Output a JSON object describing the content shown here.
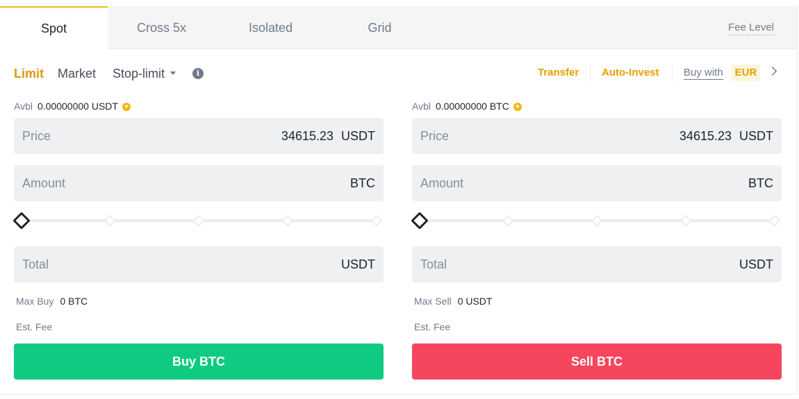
{
  "tabs": [
    {
      "label": "Spot",
      "active": true
    },
    {
      "label": "Cross 5x",
      "active": false
    },
    {
      "label": "Isolated",
      "active": false
    },
    {
      "label": "Grid",
      "active": false
    }
  ],
  "fee_level": "Fee Level",
  "order_types": {
    "limit": "Limit",
    "market": "Market",
    "stop_limit": "Stop-limit",
    "active": "Limit"
  },
  "actions": {
    "transfer": "Transfer",
    "auto_invest": "Auto-Invest",
    "buy_with": "Buy with",
    "currency": "EUR"
  },
  "buy_panel": {
    "avbl_label": "Avbl",
    "avbl_value": "0.00000000 USDT",
    "price_label": "Price",
    "price_value": "34615.23",
    "price_unit": "USDT",
    "amount_label": "Amount",
    "amount_unit": "BTC",
    "slider_percent": 0,
    "total_label": "Total",
    "total_unit": "USDT",
    "max_label": "Max Buy",
    "max_value": "0 BTC",
    "fee_label": "Est. Fee",
    "button_label": "Buy BTC"
  },
  "sell_panel": {
    "avbl_label": "Avbl",
    "avbl_value": "0.00000000 BTC",
    "price_label": "Price",
    "price_value": "34615.23",
    "price_unit": "USDT",
    "amount_label": "Amount",
    "amount_unit": "BTC",
    "slider_percent": 0,
    "total_label": "Total",
    "total_unit": "USDT",
    "max_label": "Max Sell",
    "max_value": "0 USDT",
    "fee_label": "Est. Fee",
    "button_label": "Sell BTC"
  },
  "colors": {
    "accent": "#f0b90b",
    "buy": "#0ecb81",
    "sell": "#f6465d"
  },
  "icons": {
    "info": "info-icon",
    "add_funds": "plus-circle-icon",
    "dropdown": "caret-down-icon",
    "more": "chevron-right-icon"
  }
}
